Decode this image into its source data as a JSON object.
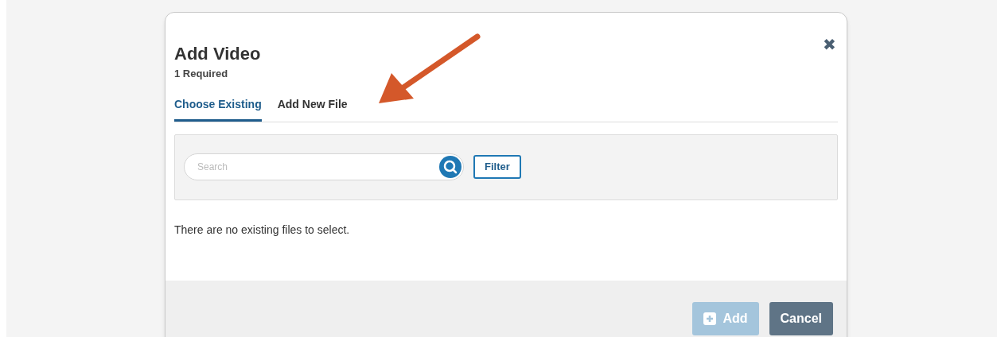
{
  "dialog": {
    "title": "Add Video",
    "subtitle": "1 Required",
    "close": "✖"
  },
  "tabs": [
    {
      "label": "Choose Existing",
      "selected": true
    },
    {
      "label": "Add New File",
      "selected": false
    }
  ],
  "search": {
    "placeholder": "Search"
  },
  "filter_button": "Filter",
  "empty_message": "There are no existing files to select.",
  "footer": {
    "add": {
      "label": "Add",
      "disabled": true
    },
    "cancel": {
      "label": "Cancel"
    }
  }
}
